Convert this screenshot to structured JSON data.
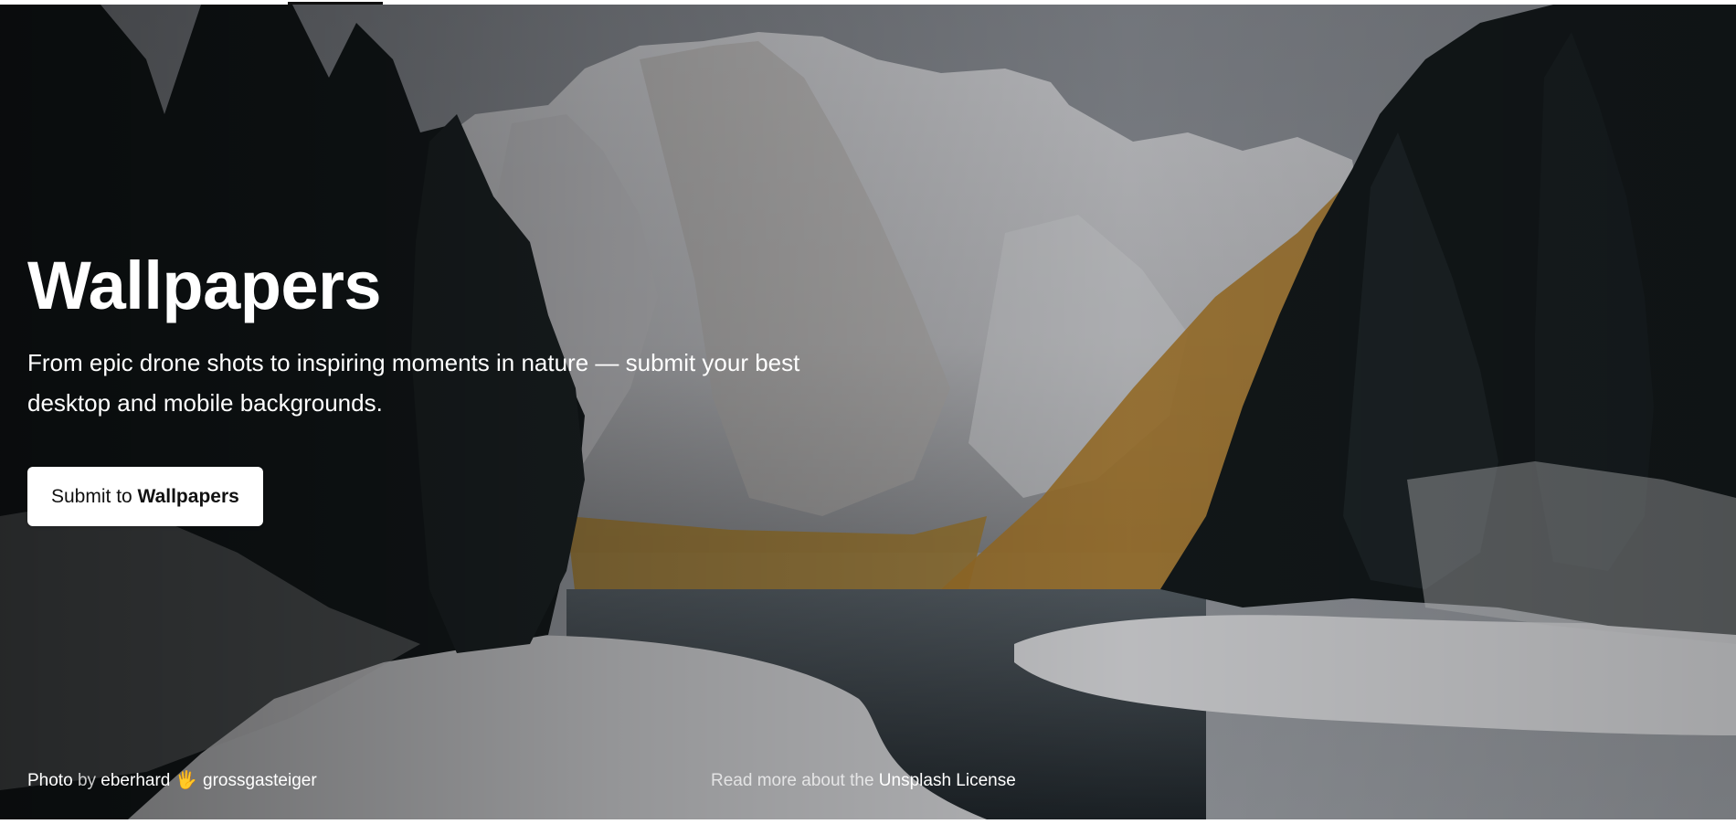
{
  "hero": {
    "title": "Wallpapers",
    "description_line1": "From epic drone shots to inspiring moments in nature — submit your best",
    "description_line2": "desktop and mobile backgrounds.",
    "submit_button": {
      "prefix": "Submit to ",
      "topic": "Wallpapers"
    },
    "photo": {
      "subject": "snowy mountain lake with pine forest",
      "overlay_color": "#000000",
      "accent_colors": {
        "sky": "#8f949b",
        "snow": "#e6e7ea",
        "forest": "#1b2225",
        "larch": "#c58b32",
        "water": "#3b4248"
      }
    }
  },
  "footer": {
    "photo_label": "Photo",
    "by_label": "by",
    "photographer_first": "eberhard",
    "photographer_icon": "waving-hand-icon",
    "photographer_icon_glyph": "🖐",
    "photographer_last": "grossgasteiger",
    "license_prefix": "Read more about the",
    "license_link": "Unsplash License"
  }
}
